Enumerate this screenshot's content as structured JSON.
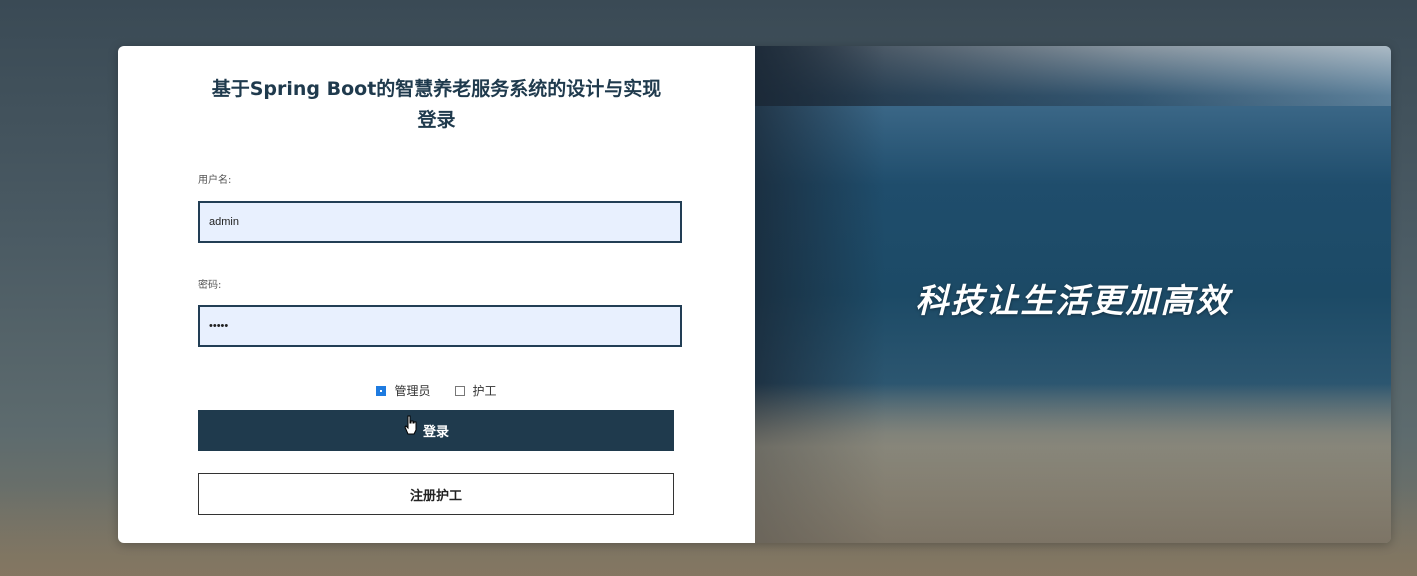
{
  "login": {
    "title_line1": "基于Spring Boot的智慧养老服务系统的设计与实现",
    "title_line2": "登录",
    "username_label": "用户名:",
    "username_value": "admin",
    "password_label": "密码:",
    "password_value": "•••••",
    "roles": [
      {
        "label": "管理员",
        "checked": true
      },
      {
        "label": "护工",
        "checked": false
      }
    ],
    "login_button": "登录",
    "register_button": "注册护工"
  },
  "banner": {
    "slogan": "科技让生活更加高效"
  },
  "colors": {
    "primary": "#1f3a4d",
    "input_bg": "#e8f0fe",
    "checkbox_checked": "#1e7be0"
  }
}
